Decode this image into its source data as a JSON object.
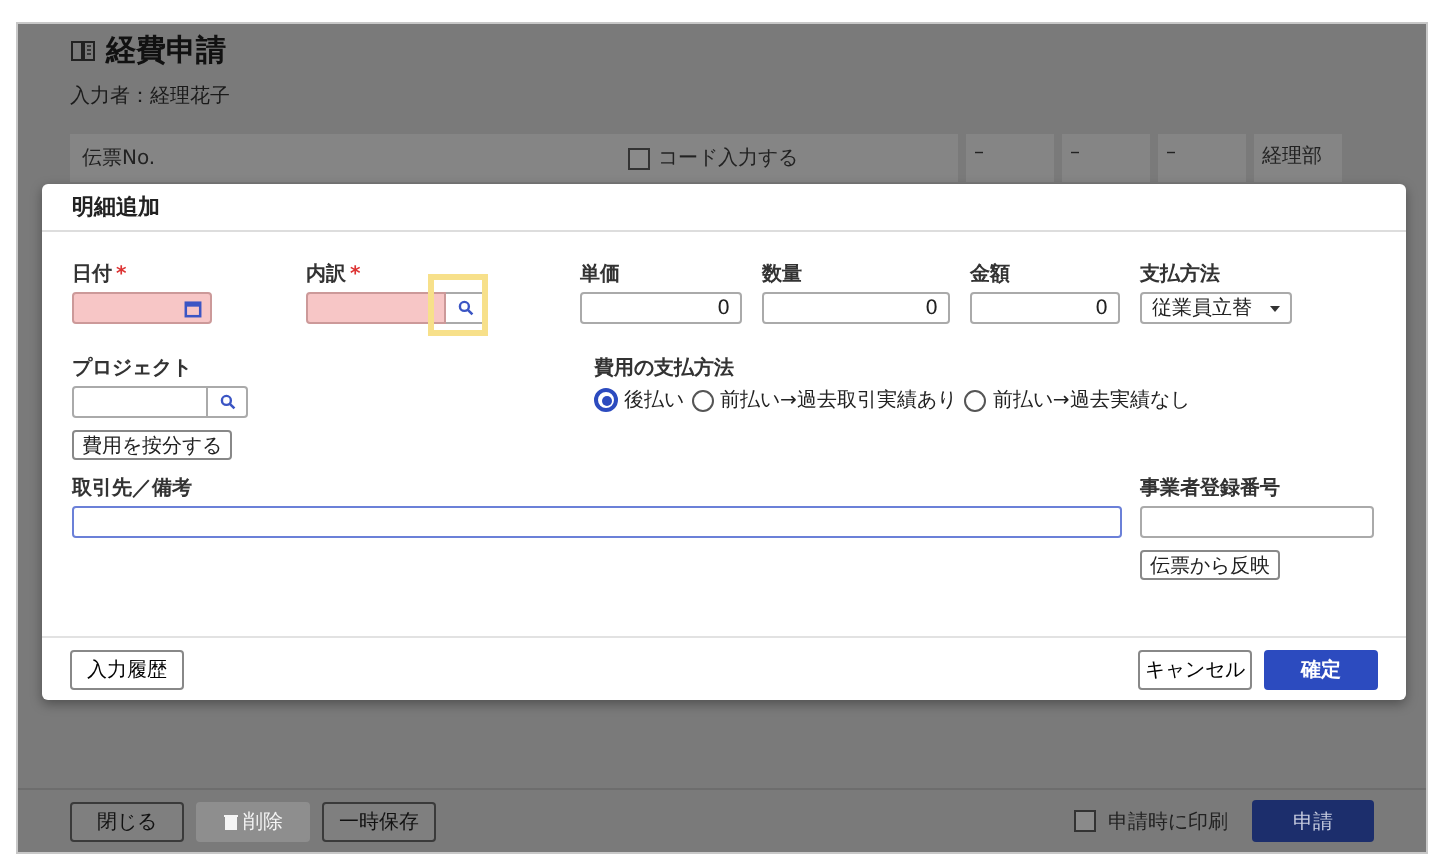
{
  "page": {
    "title": "経費申請",
    "entered_by": "入力者：経理花子",
    "header_row": {
      "slip_label": "伝票No.",
      "code_input": {
        "label": "コード入力する",
        "checked": false
      },
      "cells": [
        "–",
        "–",
        "–",
        "経理部"
      ]
    }
  },
  "dialog": {
    "title": "明細追加",
    "fields": [
      {
        "label": "日付",
        "required_mark": "*",
        "kind": "date",
        "invalid": true
      },
      {
        "label": "内訳",
        "required_mark": "*",
        "kind": "lookup",
        "invalid": true,
        "highlighted": true
      },
      {
        "label": "単価",
        "kind": "number",
        "value": "0"
      },
      {
        "label": "数量",
        "kind": "number",
        "value": "0"
      },
      {
        "label": "金額",
        "kind": "number",
        "value": "0"
      },
      {
        "label": "支払方法",
        "kind": "select",
        "value": "従業員立替"
      }
    ],
    "project": {
      "label": "プロジェクト",
      "allocate_button": "費用を按分する"
    },
    "payment_timing": {
      "label": "費用の支払方法",
      "options": [
        {
          "label": "後払い",
          "selected": true
        },
        {
          "label": "前払い→過去取引実績あり",
          "selected": false
        },
        {
          "label": "前払い→過去実績なし",
          "selected": false
        }
      ]
    },
    "notes": {
      "label": "取引先／備考",
      "focused": true
    },
    "registration": {
      "label": "事業者登録番号",
      "reflect_button": "伝票から反映"
    },
    "history_button": "入力履歴",
    "cancel_button": "キャンセル",
    "confirm_button": "確定"
  },
  "footer": {
    "buttons": [
      {
        "label": "閉じる",
        "kind": "plain",
        "disabled": false
      },
      {
        "label": "削除",
        "kind": "delete",
        "disabled": true
      },
      {
        "label": "一時保存",
        "kind": "plain",
        "disabled": false
      }
    ],
    "print_on_submit": {
      "label": "申請時に印刷",
      "checked": false
    },
    "submit_button": "申請"
  }
}
